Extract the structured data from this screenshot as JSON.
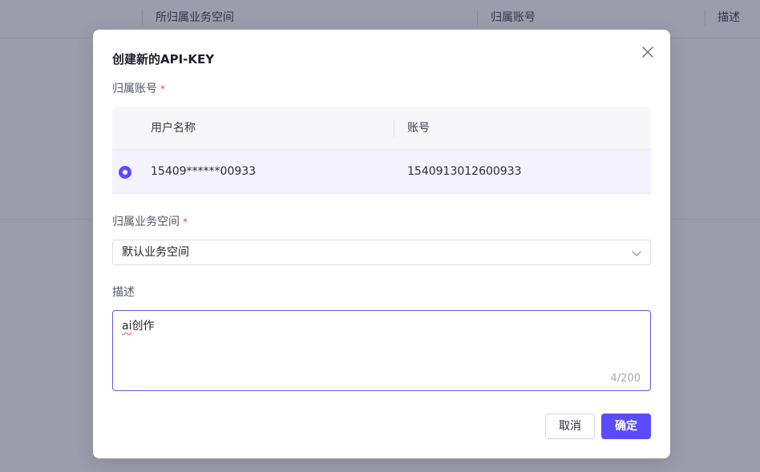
{
  "background": {
    "columns": [
      "所归属业务空间",
      "归属账号",
      "描述"
    ]
  },
  "modal": {
    "title": "创建新的API-KEY",
    "account_label": "归属账号",
    "required_mark": "*",
    "table": {
      "headers": [
        "用户名称",
        "账号"
      ],
      "rows": [
        {
          "username": "15409******00933",
          "account": "1540913012600933",
          "selected": true
        }
      ]
    },
    "workspace_label": "归属业务空间",
    "workspace_value": "默认业务空间",
    "description_label": "描述",
    "description_value_prefix": "ai",
    "description_value_suffix": "创作",
    "description_counter": "4/200",
    "cancel_label": "取消",
    "ok_label": "确定"
  },
  "colors": {
    "accent": "#5b4bff",
    "mask": "#3c3a5a",
    "required": "#e5484d"
  },
  "icons": {
    "close": "close-icon",
    "select": "chevron-down-icon",
    "radio": "radio-checked-icon"
  }
}
